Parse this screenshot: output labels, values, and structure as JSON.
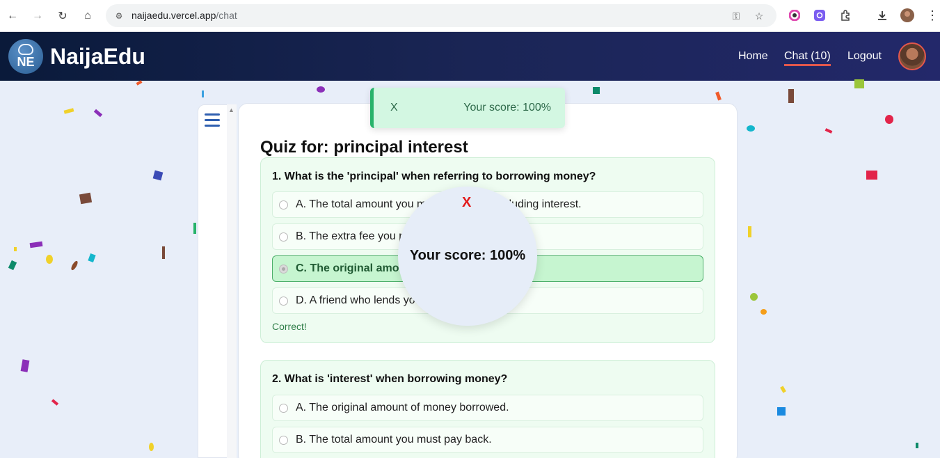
{
  "browser": {
    "url_host": "naijaedu.vercel.app",
    "url_path": "/chat",
    "icons": [
      "back-icon",
      "forward-icon",
      "reload-icon",
      "home-icon",
      "site-info-icon",
      "password-key-icon",
      "bookmark-star-icon",
      "extension-color-icon",
      "extension-gear-icon",
      "extensions-puzzle-icon",
      "download-icon",
      "profile-icon",
      "menu-icon"
    ]
  },
  "header": {
    "logo_text": "NE",
    "brand": "NaijaEdu",
    "nav": [
      {
        "label": "Home"
      },
      {
        "label": "Chat (10)",
        "active": true
      },
      {
        "label": "Logout"
      }
    ],
    "accent_color": "#e2574c"
  },
  "toast": {
    "close": "X",
    "message": "Your score: 100%"
  },
  "score_bubble": {
    "close": "X",
    "message": "Your score: 100%"
  },
  "quiz": {
    "title": "Quiz for: principal interest",
    "questions": [
      {
        "text": "1. What is the 'principal' when referring to borrowing money?",
        "options": [
          {
            "label": "A. The total amount you must pay back, including interest."
          },
          {
            "label": "B. The extra fee you pay for borrowing money."
          },
          {
            "label": "C. The original amount of money borrowed.",
            "selected": true
          },
          {
            "label": "D. A friend who lends you money."
          }
        ],
        "feedback": "Correct!"
      },
      {
        "text": "2. What is 'interest' when borrowing money?",
        "options": [
          {
            "label": "A. The original amount of money borrowed."
          },
          {
            "label": "B. The total amount you must pay back."
          }
        ]
      }
    ]
  }
}
